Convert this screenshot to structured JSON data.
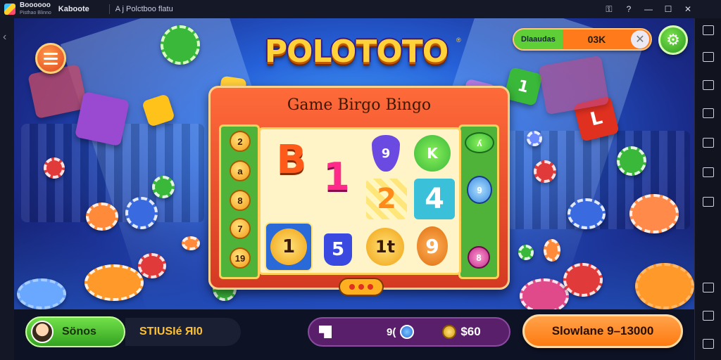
{
  "titlebar": {
    "app_name": "Boooooo",
    "app_sub": "Pisthao Blinno",
    "home_label": "Kaboote",
    "tab_label": "A  j  Polctboo  flatu",
    "icons": [
      "key-icon",
      "help-icon",
      "minimize-icon",
      "maximize-icon",
      "close-icon"
    ]
  },
  "game": {
    "logo_text": "POLOTOTO",
    "logo_mark": "®",
    "currency_label": "Dlaaudas",
    "currency_value": "03K",
    "board_title": "Game Birgo Bingo",
    "left_balls": [
      "2",
      "a",
      "8",
      "7",
      "19"
    ],
    "right_balls": [
      "ʎ",
      "9",
      "",
      "",
      "8"
    ],
    "cells": {
      "b": "B",
      "one": "1",
      "shield": "9",
      "green_k": "K",
      "two": "2",
      "four": "4",
      "coin_one": "1",
      "five": "5",
      "it": "1t",
      "nine": "9"
    },
    "dice": [
      "L",
      "1",
      "∧"
    ]
  },
  "bottombar": {
    "bonus_label": "Sönos",
    "status_text": "STIUSIé ЯI0",
    "balance_a": "9(",
    "balance_b": "$60",
    "action_label": "Slowlane 9–13000"
  },
  "colors": {
    "accent_orange": "#ff7a1a",
    "accent_green": "#4fb33a",
    "board_red": "#d43a22",
    "balance_purple": "#5a1f6a"
  }
}
